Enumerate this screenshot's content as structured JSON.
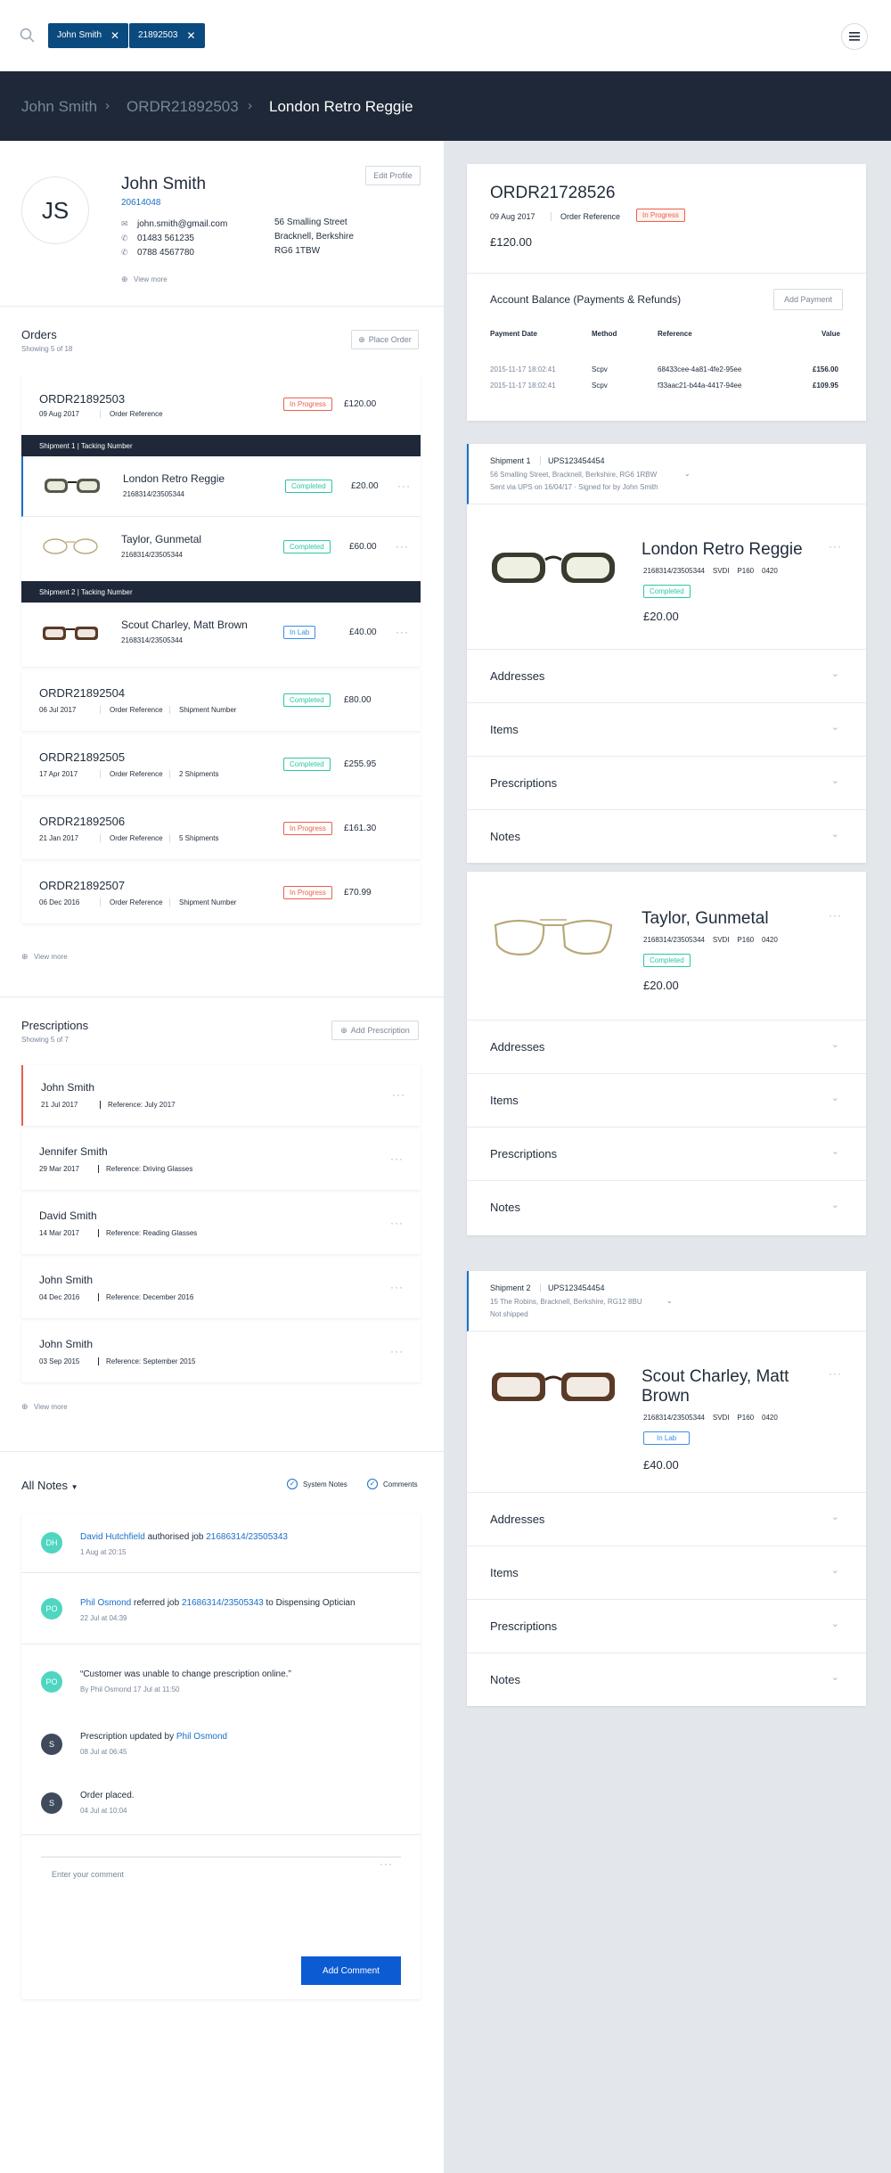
{
  "search": {
    "chips": [
      "John Smith",
      "21892503"
    ]
  },
  "breadcrumb": [
    "John Smith",
    "ORDR21892503",
    "London Retro Reggie"
  ],
  "profile": {
    "initials": "JS",
    "name": "John Smith",
    "id": "20614048",
    "email": "john.smith@gmail.com",
    "phone1": "01483 561235",
    "phone2": "0788 4567780",
    "address": [
      "56 Smalling Street",
      "Bracknell, Berkshire",
      "RG6 1TBW"
    ],
    "edit": "Edit Profile",
    "view_more": "View more"
  },
  "orders": {
    "title": "Orders",
    "count": "Showing 5 of 18",
    "place": "Place Order",
    "view_more": "View more",
    "current": {
      "id": "ORDR21892503",
      "date": "09 Aug 2017",
      "ref": "Order Reference",
      "status": "In Progress",
      "price": "£120.00"
    },
    "shipment1": "Shipment 1 | Tacking Number",
    "shipment2": "Shipment 2 | Tacking Number",
    "items": [
      {
        "name": "London Retro Reggie",
        "code": "2168314/23505344",
        "status": "Completed",
        "price": "£20.00"
      },
      {
        "name": "Taylor, Gunmetal",
        "code": "2168314/23505344",
        "status": "Completed",
        "price": "£60.00"
      },
      {
        "name": "Scout Charley, Matt Brown",
        "code": "2168314/23505344",
        "status": "In Lab",
        "price": "£40.00"
      }
    ],
    "list": [
      {
        "id": "ORDR21892504",
        "date": "06 Jul 2017",
        "ref": "Order Reference",
        "extra": "Shipment Number",
        "status": "Completed",
        "price": "£80.00"
      },
      {
        "id": "ORDR21892505",
        "date": "17 Apr 2017",
        "ref": "Order Reference",
        "extra": "2 Shipments",
        "status": "Completed",
        "price": "£255.95"
      },
      {
        "id": "ORDR21892506",
        "date": "21 Jan 2017",
        "ref": "Order Reference",
        "extra": "5 Shipments",
        "status": "In Progress",
        "price": "£161.30"
      },
      {
        "id": "ORDR21892507",
        "date": "06 Dec 2016",
        "ref": "Order Reference",
        "extra": "Shipment Number",
        "status": "In Progress",
        "price": "£70.99"
      }
    ]
  },
  "prescriptions": {
    "title": "Prescriptions",
    "count": "Showing 5 of 7",
    "add": "Add Prescription",
    "view_more": "View more",
    "list": [
      {
        "name": "John Smith",
        "date": "21 Jul 2017",
        "ref": "Reference: July 2017"
      },
      {
        "name": "Jennifer Smith",
        "date": "29 Mar 2017",
        "ref": "Reference: Driving Glasses"
      },
      {
        "name": "David Smith",
        "date": "14 Mar 2017",
        "ref": "Reference: Reading Glasses"
      },
      {
        "name": "John Smith",
        "date": "04 Dec 2016",
        "ref": "Reference: December 2016"
      },
      {
        "name": "John Smith",
        "date": "03 Sep 2015",
        "ref": "Reference: September 2015"
      }
    ]
  },
  "notes": {
    "title": "All Notes",
    "system": "System Notes",
    "comments": "Comments",
    "placeholder": "Enter your comment",
    "add": "Add Comment",
    "list": [
      {
        "initials": "DH",
        "color": "#4fd6c0",
        "pre": "",
        "link": "David Hutchfield",
        "mid": " authorised job ",
        "link2": "21686314/23505343",
        "post": "",
        "time": "1 Aug at 20:15"
      },
      {
        "initials": "PO",
        "color": "#4fd6c0",
        "pre": "",
        "link": "Phil Osmond",
        "mid": " referred job ",
        "link2": "21686314/23505343",
        "post": " to Dispensing Optician",
        "time": "22 Jul at 04:39"
      },
      {
        "initials": "PO",
        "color": "#4fd6c0",
        "pre": "“Customer was unable to change prescription online.”",
        "link": "",
        "mid": "",
        "link2": "",
        "post": "",
        "time": "By Phil Osmond 17 Jul at 11:50"
      },
      {
        "initials": "S",
        "color": "#3f4b5c",
        "pre": "Prescription updated by ",
        "link": "Phil Osmond",
        "mid": "",
        "link2": "",
        "post": "",
        "time": "08 Jul at 06:45"
      },
      {
        "initials": "S",
        "color": "#3f4b5c",
        "pre": "Order placed.",
        "link": "",
        "mid": "",
        "link2": "",
        "post": "",
        "time": "04 Jul at 10:04"
      }
    ]
  },
  "order_card": {
    "id": "ORDR21728526",
    "date": "09 Aug 2017",
    "ref": "Order Reference",
    "status": "In Progress",
    "total": "£120.00",
    "balance_title": "Account Balance (Payments & Refunds)",
    "add_payment": "Add Payment",
    "cols": [
      "Payment Date",
      "Method",
      "Reference",
      "Value"
    ],
    "rows": [
      [
        "2015-11-17 18:02:41",
        "Scpv",
        "68433cee-4a81-4fe2-95ee",
        "£156.00"
      ],
      [
        "2015-11-17 18:02:41",
        "Scpv",
        "f33aac21-b44a-4417-94ee",
        "£109.95"
      ]
    ]
  },
  "shipments": [
    {
      "label": "Shipment 1",
      "tracking": "UPS123454454",
      "address": "56 Smalling Street, Bracknell, Berkshire, RG6 1RBW",
      "sent": "Sent via UPS on 16/04/17  ·  Signed for by John Smith"
    },
    {
      "label": "Shipment 2",
      "tracking": "UPS123454454",
      "address": "15 The Robins, Bracknell, Berkshire, RG12 8BU",
      "sent": "Not shipped"
    }
  ],
  "products": [
    {
      "name": "London Retro Reggie",
      "code": "2168314/23505344",
      "svdi": "SVDI",
      "p": "P160",
      "n": "0420",
      "status": "Completed",
      "price": "£20.00"
    },
    {
      "name": "Taylor, Gunmetal",
      "code": "2168314/23505344",
      "svdi": "SVDI",
      "p": "P160",
      "n": "0420",
      "status": "Completed",
      "price": "£20.00"
    },
    {
      "name": "Scout Charley, Matt Brown",
      "code": "2168314/23505344",
      "svdi": "SVDI",
      "p": "P160",
      "n": "0420",
      "status": "In Lab",
      "price": "£40.00"
    }
  ],
  "accordion": [
    "Addresses",
    "Items",
    "Prescriptions",
    "Notes"
  ]
}
